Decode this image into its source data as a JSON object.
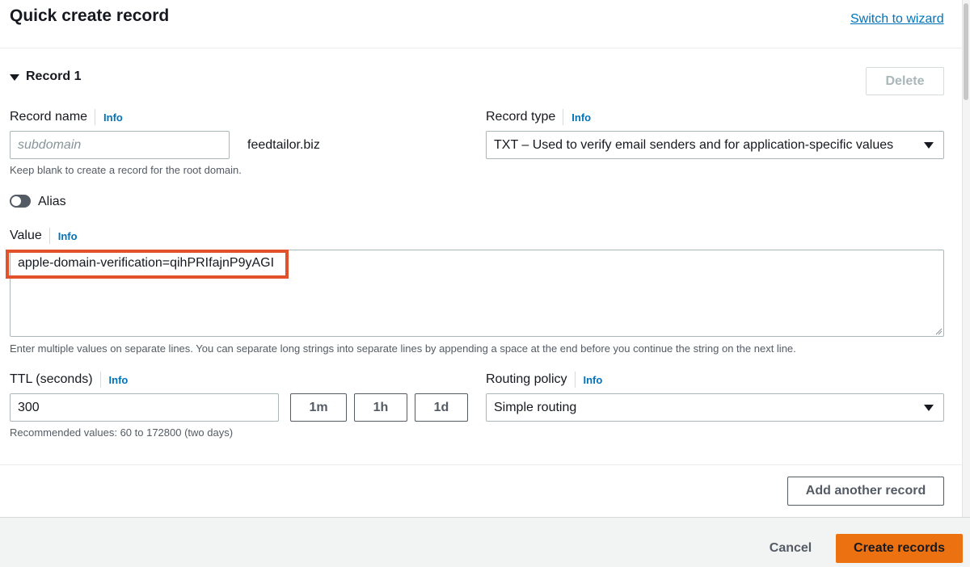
{
  "header": {
    "title": "Quick create record",
    "switch_to_wizard": "Switch to wizard"
  },
  "record": {
    "section_label": "Record 1",
    "delete_label": "Delete",
    "record_name": {
      "label": "Record name",
      "info": "Info",
      "placeholder": "subdomain",
      "value": "",
      "domain_suffix": "feedtailor.biz",
      "hint": "Keep blank to create a record for the root domain."
    },
    "record_type": {
      "label": "Record type",
      "info": "Info",
      "selected": "TXT – Used to verify email senders and for application-specific values"
    },
    "alias": {
      "label": "Alias",
      "enabled": false
    },
    "value": {
      "label": "Value",
      "info": "Info",
      "text": "apple-domain-verification=qihPRIfajnP9yAGI",
      "hint": "Enter multiple values on separate lines. You can separate long strings into separate lines by appending a space at the end before you continue the string on the next line.",
      "highlight_color": "#e2522a"
    },
    "ttl": {
      "label": "TTL (seconds)",
      "info": "Info",
      "value": "300",
      "presets": [
        "1m",
        "1h",
        "1d"
      ],
      "hint": "Recommended values: 60 to 172800 (two days)"
    },
    "routing_policy": {
      "label": "Routing policy",
      "info": "Info",
      "selected": "Simple routing"
    }
  },
  "actions": {
    "add_another": "Add another record",
    "cancel": "Cancel",
    "create": "Create records",
    "primary_color": "#ec7211"
  }
}
